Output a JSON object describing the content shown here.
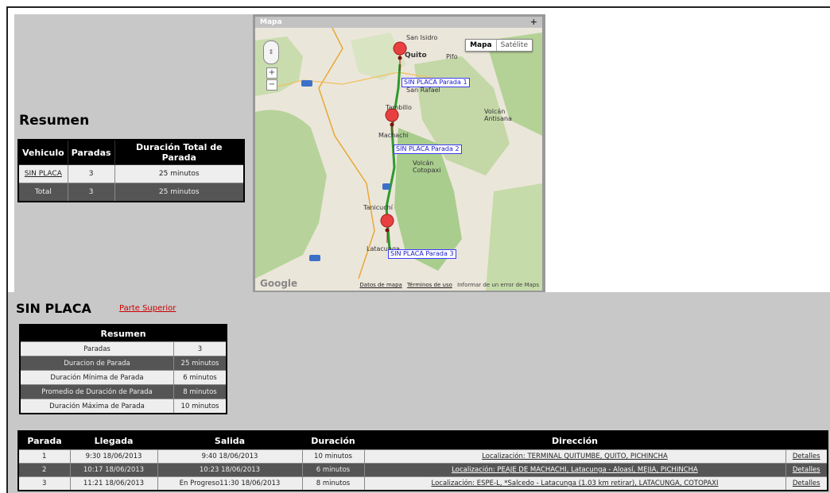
{
  "summary": {
    "title": "Resumen",
    "headers": [
      "Vehiculo",
      "Paradas",
      "Duración Total de Parada"
    ],
    "rows": [
      {
        "vehicle": "SIN PLACA",
        "stops": "3",
        "duration": "25 minutos"
      },
      {
        "vehicle": "Total",
        "stops": "3",
        "duration": "25 minutos"
      }
    ]
  },
  "map": {
    "title": "Mapa",
    "maptype": {
      "map": "Mapa",
      "satellite": "Satélite"
    },
    "labels": [
      "SIN PLACA Parada 1",
      "SIN PLACA Parada 2",
      "SIN PLACA Parada 3"
    ],
    "places": [
      "San Isidro",
      "Quito",
      "Pifo",
      "San Rafael",
      "Tambillo",
      "Volcán Antisana",
      "Machachi",
      "Volcán Cotopaxi",
      "Tanicuchí",
      "Latacunga"
    ],
    "footer": {
      "data": "Datos de mapa",
      "terms": "Términos de uso",
      "report": "Informar de un error de Maps"
    },
    "logo": "Google"
  },
  "vehicle_section": {
    "title": "SIN PLACA",
    "top_link": "Parte Superior",
    "stats_title": "Resumen",
    "stats": [
      {
        "label": "Paradas",
        "value": "3"
      },
      {
        "label": "Duracion de Parada",
        "value": "25 minutos"
      },
      {
        "label": "Duración Mínima de Parada",
        "value": "6 minutos"
      },
      {
        "label": "Promedio de Duración de Parada",
        "value": "8 minutos"
      },
      {
        "label": "Duración Máxima de Parada",
        "value": "10 minutos"
      }
    ],
    "stops_headers": [
      "Parada",
      "Llegada",
      "Salida",
      "Duración",
      "Dirección",
      ""
    ],
    "stops": [
      {
        "n": "1",
        "arrival": "9:30 18/06/2013",
        "departure": "9:40 18/06/2013",
        "duration": "10 minutos",
        "address": "Localización: TERMINAL QUITUMBE, QUITO, PICHINCHA",
        "details": "Detalles"
      },
      {
        "n": "2",
        "arrival": "10:17 18/06/2013",
        "departure": "10:23 18/06/2013",
        "duration": "6 minutos",
        "address": "Localización: PEAJE DE MACHACHI, Latacunga - Aloasí, MEJIA, PICHINCHA",
        "details": "Detalles"
      },
      {
        "n": "3",
        "arrival": "11:21 18/06/2013",
        "departure": "En Progreso11:30 18/06/2013",
        "duration": "8 minutos",
        "address": "Localización: ESPE-L, *Salcedo - Latacunga (1.03 km retirar), LATACUNGA, COTOPAXI",
        "details": "Detalles"
      }
    ]
  },
  "colors": {
    "panel": "#c8c8c8",
    "header": "#000000",
    "dark_row": "#555555",
    "light_row": "#eeeeee",
    "link_red": "#cc0000",
    "route": "#2e9a2e",
    "marker": "#e84040"
  }
}
